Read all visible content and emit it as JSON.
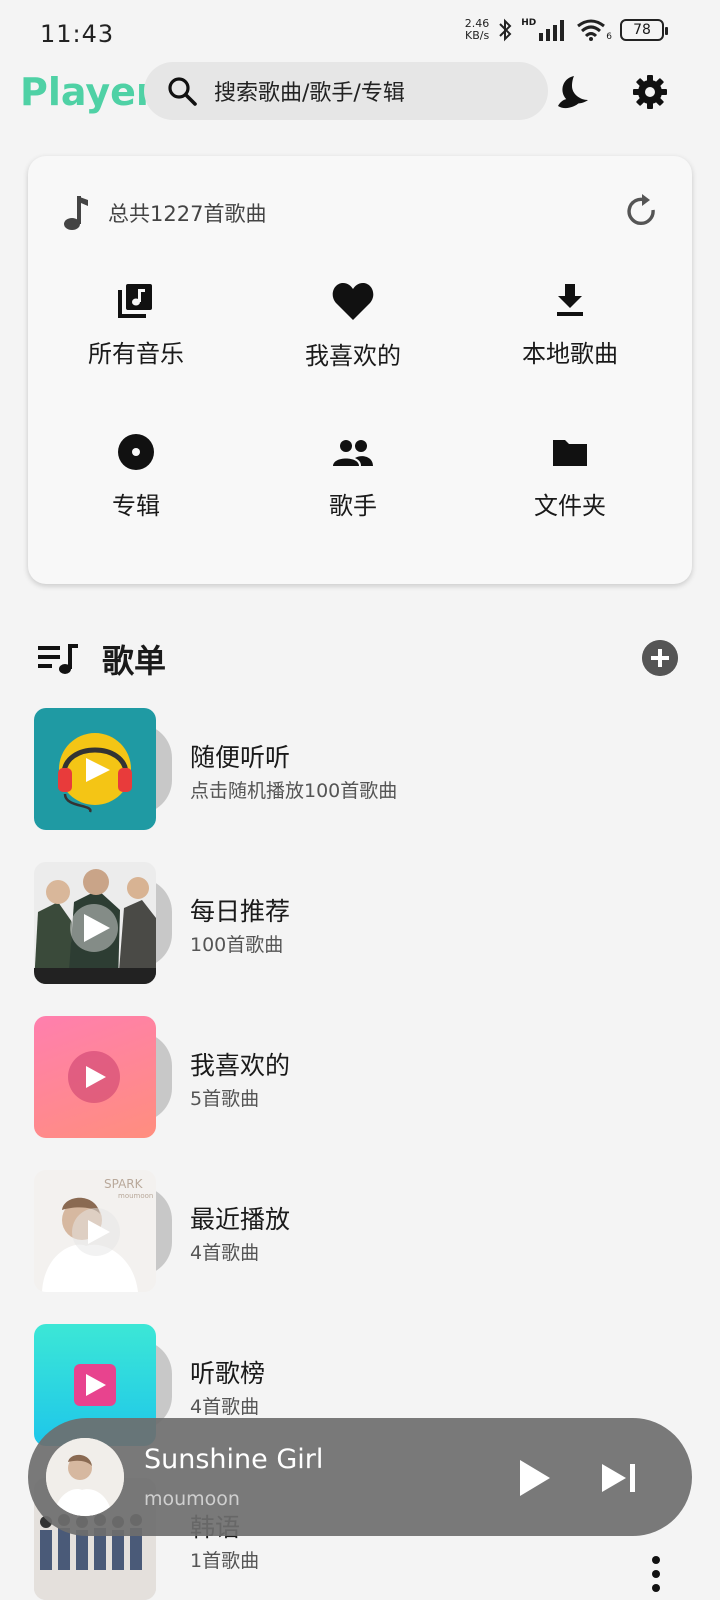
{
  "status": {
    "time": "11:43",
    "speed_top": "2.46",
    "speed_bottom": "KB/s",
    "battery": "78",
    "signal_label": "HD",
    "wifi_sub": "6"
  },
  "header": {
    "logo": "Player",
    "search_placeholder": "搜索歌曲/歌手/专辑"
  },
  "library": {
    "total": "总共1227首歌曲",
    "items": [
      {
        "label": "所有音乐",
        "icon": "library-music-icon"
      },
      {
        "label": "我喜欢的",
        "icon": "heart-icon"
      },
      {
        "label": "本地歌曲",
        "icon": "download-icon"
      },
      {
        "label": "专辑",
        "icon": "album-icon"
      },
      {
        "label": "歌手",
        "icon": "people-icon"
      },
      {
        "label": "文件夹",
        "icon": "folder-icon"
      }
    ]
  },
  "playlists": {
    "title": "歌单",
    "items": [
      {
        "name": "随便听听",
        "sub": "点击随机播放100首歌曲",
        "cover": "teal"
      },
      {
        "name": "每日推荐",
        "sub": "100首歌曲",
        "cover": "photo"
      },
      {
        "name": "我喜欢的",
        "sub": "5首歌曲",
        "cover": "pink"
      },
      {
        "name": "最近播放",
        "sub": "4首歌曲",
        "cover": "portrait"
      },
      {
        "name": "听歌榜",
        "sub": "4首歌曲",
        "cover": "cyan"
      },
      {
        "name": "韩语",
        "sub": "1首歌曲",
        "cover": "group"
      }
    ]
  },
  "mini_player": {
    "title": "Sunshine Girl",
    "artist": "moumoon"
  },
  "colors": {
    "accent": "#4fd1a5",
    "background": "#f4f4f4",
    "mini_player": "#6e6e6e"
  }
}
